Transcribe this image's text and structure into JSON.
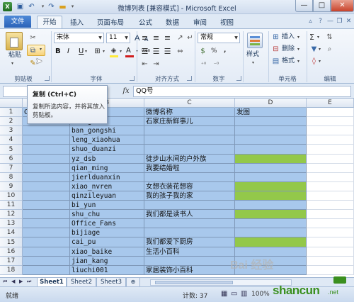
{
  "window": {
    "title": "微博列表 [兼容模式] - Microsoft Excel",
    "minimize_glyph": "—",
    "maximize_glyph": "□",
    "close_glyph": "✕"
  },
  "tabs": {
    "file": "文件",
    "items": [
      "开始",
      "插入",
      "页面布局",
      "公式",
      "数据",
      "审阅",
      "视图"
    ]
  },
  "ribbon": {
    "clipboard": {
      "paste": "粘贴",
      "label": "剪贴板"
    },
    "font": {
      "name": "宋体",
      "size": "11",
      "bold": "B",
      "italic": "I",
      "underline": "U",
      "grow": "A",
      "shrink": "A",
      "wen": "wén",
      "fontcolor": "A",
      "label": "字体"
    },
    "alignment": {
      "label": "对齐方式"
    },
    "number": {
      "format": "常规",
      "percent": "%",
      "comma": ",",
      "label": "数字"
    },
    "styles": {
      "label": "样式",
      "group_label": ""
    },
    "cells": {
      "insert": "插入",
      "delete": "删除",
      "format": "格式",
      "label": "单元格"
    },
    "editing": {
      "sigma": "Σ",
      "label": "编辑"
    }
  },
  "formula_bar": {
    "fx": "fx",
    "content": "QQ号"
  },
  "tooltip": {
    "title": "复制 (Ctrl+C)",
    "body": "复制所选内容，并将其放入剪贴板。"
  },
  "sheet": {
    "columns": [
      "A",
      "B",
      "C",
      "D",
      "E"
    ],
    "rows": [
      {
        "num": "1",
        "a": "QQ",
        "b": "",
        "c": "微博名称",
        "d": "发图",
        "green": false
      },
      {
        "num": "2",
        "a": "",
        "b": "huang",
        "c": "石家庄新鲜事儿",
        "d": "",
        "green": false
      },
      {
        "num": "3",
        "a": "",
        "b": "ban_gongshi",
        "c": "",
        "d": "",
        "green": false
      },
      {
        "num": "4",
        "a": "",
        "b": "leng_xiaohua",
        "c": "",
        "d": "",
        "green": false
      },
      {
        "num": "5",
        "a": "",
        "b": "shuo_duanzi",
        "c": "",
        "d": "",
        "green": false
      },
      {
        "num": "6",
        "a": "",
        "b": "yz_dsb",
        "c": "徒步山水间的户外族",
        "d": "",
        "green": true
      },
      {
        "num": "7",
        "a": "",
        "b": "qian_ming",
        "c": "我要结婚啦",
        "d": "",
        "green": false
      },
      {
        "num": "8",
        "a": "",
        "b": "jierlduanxin",
        "c": "",
        "d": "",
        "green": false
      },
      {
        "num": "9",
        "a": "",
        "b": "xiao_nvren",
        "c": "女想衣装花想容",
        "d": "",
        "green": true
      },
      {
        "num": "10",
        "a": "",
        "b": "qinzileyuan",
        "c": "我的孩子我的家",
        "d": "",
        "green": true
      },
      {
        "num": "11",
        "a": "",
        "b": "bi_yun",
        "c": "",
        "d": "",
        "green": false
      },
      {
        "num": "12",
        "a": "",
        "b": "shu_chu",
        "c": "我们都是读书人",
        "d": "",
        "green": true
      },
      {
        "num": "13",
        "a": "",
        "b": "Office_Fans",
        "c": "",
        "d": "",
        "green": false
      },
      {
        "num": "14",
        "a": "",
        "b": "bijiage",
        "c": "",
        "d": "",
        "green": false
      },
      {
        "num": "15",
        "a": "",
        "b": "cai_pu",
        "c": "我们都爱下厨房",
        "d": "",
        "green": true
      },
      {
        "num": "16",
        "a": "",
        "b": "xiao_baike",
        "c": "生活小百科",
        "d": "",
        "green": false
      },
      {
        "num": "17",
        "a": "",
        "b": "jian_kang",
        "c": "",
        "d": "",
        "green": false
      },
      {
        "num": "18",
        "a": "",
        "b": "liuchi001",
        "c": "家居装饰小百科",
        "d": "",
        "green": false
      }
    ],
    "tabs": [
      "Sheet1",
      "Sheet2",
      "Sheet3"
    ]
  },
  "status": {
    "ready": "就绪",
    "count": "计数: 37",
    "zoom": "100%"
  },
  "watermark": {
    "site": "shancun",
    "tld": ".net",
    "baidu": "Bai 经验"
  },
  "colors": {
    "cell_blue": "#a8c8ec",
    "cell_green": "#93c84a",
    "ribbon_bg": "#dfe9f5",
    "accent": "#2a62b8"
  }
}
